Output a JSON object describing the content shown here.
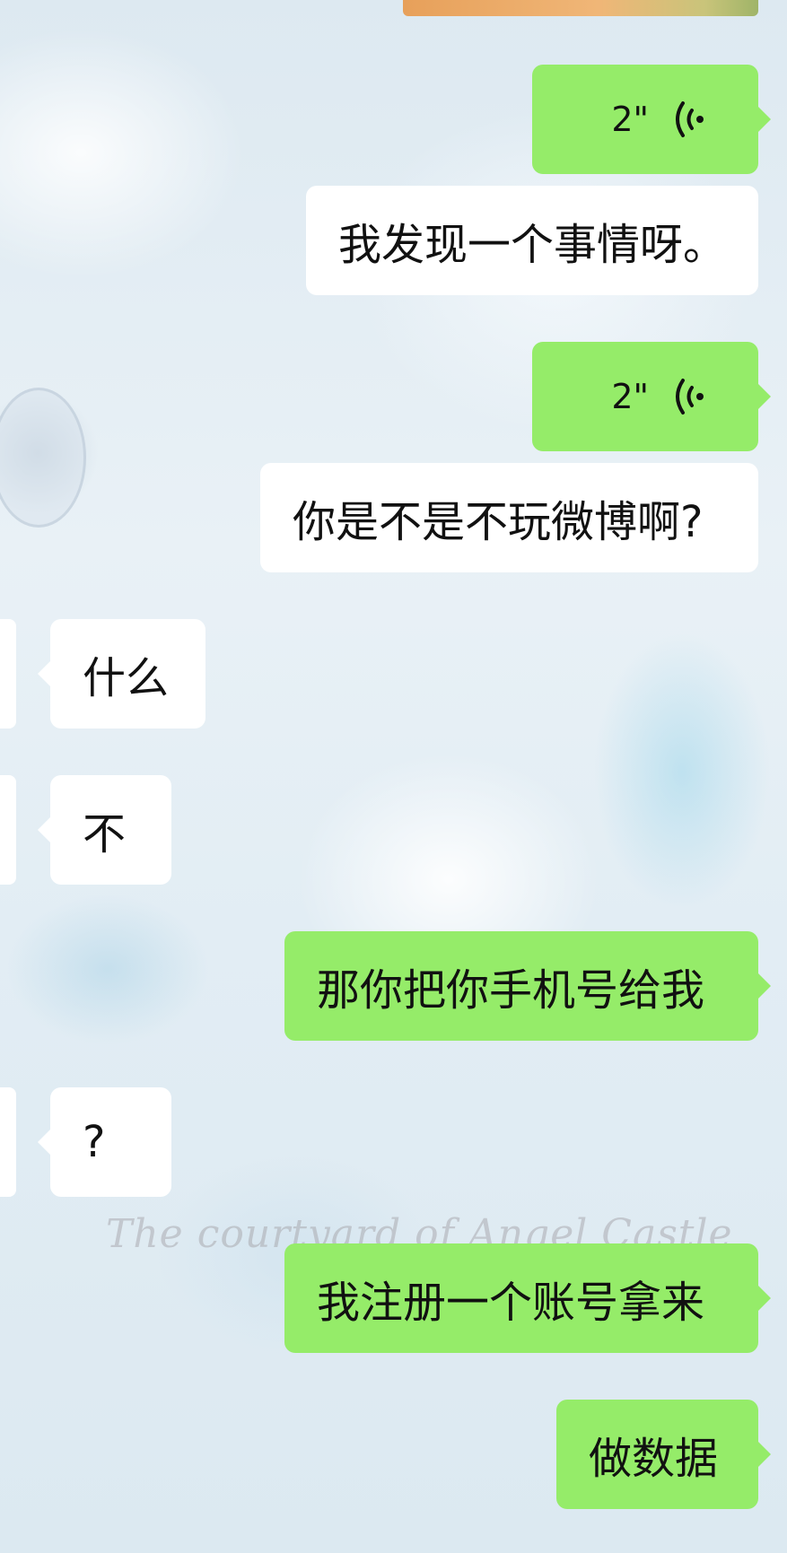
{
  "messages": [
    {
      "type": "voice",
      "side": "outgoing",
      "duration": "2\""
    },
    {
      "type": "text",
      "side": "outgoing",
      "text": "我发现一个事情呀。"
    },
    {
      "type": "voice",
      "side": "outgoing",
      "duration": "2\""
    },
    {
      "type": "text",
      "side": "outgoing",
      "text": "你是不是不玩微博啊?"
    },
    {
      "type": "text",
      "side": "incoming",
      "text": "什么"
    },
    {
      "type": "text",
      "side": "incoming",
      "text": "不"
    },
    {
      "type": "text",
      "side": "outgoing",
      "text": "那你把你手机号给我"
    },
    {
      "type": "text",
      "side": "incoming",
      "text": "?"
    },
    {
      "type": "text",
      "side": "outgoing",
      "text": "我注册一个账号拿来"
    },
    {
      "type": "text",
      "side": "outgoing",
      "text": "做数据"
    }
  ],
  "background": {
    "watermark_text": "The courtyard of Angel Castle"
  },
  "colors": {
    "outgoing_bubble": "#95ec69",
    "incoming_bubble": "#ffffff",
    "text": "#111111"
  },
  "icons": {
    "voice": "voice-wave-icon"
  }
}
